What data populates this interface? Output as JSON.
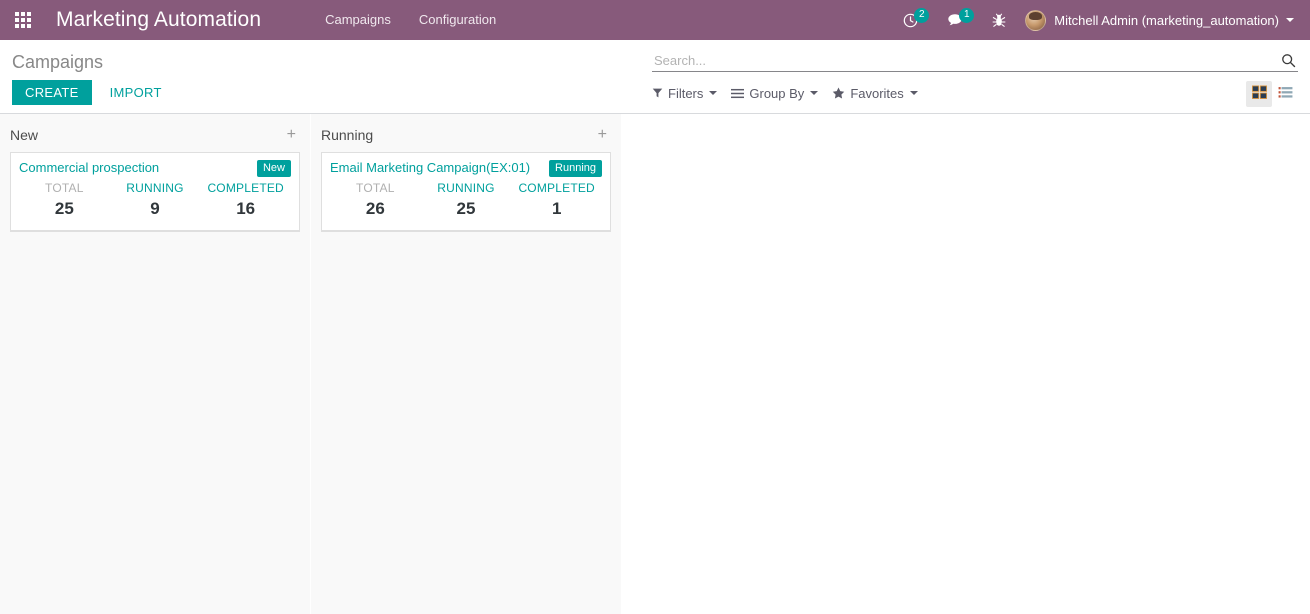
{
  "navbar": {
    "apps_icon": "apps-grid-icon",
    "brand": "Marketing Automation",
    "menu": [
      {
        "label": "Campaigns"
      },
      {
        "label": "Configuration"
      }
    ],
    "systray": {
      "activities_icon": "clock-icon",
      "activities_count": "2",
      "messages_icon": "chat-bubble-icon",
      "messages_count": "1",
      "debug_icon": "bug-icon"
    },
    "user": {
      "name": "Mitchell Admin (marketing_automation)",
      "avatar_icon": "avatar-icon",
      "caret_icon": "chevron-down-icon"
    }
  },
  "control_panel": {
    "breadcrumb": "Campaigns",
    "create_label": "CREATE",
    "import_label": "IMPORT",
    "search": {
      "placeholder": "Search...",
      "value": "",
      "icon": "search-icon"
    },
    "dropdowns": [
      {
        "label": "Filters",
        "icon": "filter-funnel-icon"
      },
      {
        "label": "Group By",
        "icon": "group-bars-icon"
      },
      {
        "label": "Favorites",
        "icon": "star-icon"
      }
    ],
    "views": [
      {
        "name": "kanban",
        "icon": "kanban-grid-icon",
        "active": true
      },
      {
        "name": "list",
        "icon": "list-view-icon",
        "active": false
      }
    ]
  },
  "kanban": {
    "add_icon": "plus-icon",
    "columns": [
      {
        "title": "New",
        "cards": [
          {
            "title": "Commercial prospection",
            "state": "New",
            "stats": [
              {
                "label": "TOTAL",
                "value": "25",
                "style": "muted"
              },
              {
                "label": "RUNNING",
                "value": "9",
                "style": "link"
              },
              {
                "label": "COMPLETED",
                "value": "16",
                "style": "link"
              }
            ]
          }
        ]
      },
      {
        "title": "Running",
        "cards": [
          {
            "title": "Email Marketing Campaign(EX:01)",
            "state": "Running",
            "stats": [
              {
                "label": "TOTAL",
                "value": "26",
                "style": "muted"
              },
              {
                "label": "RUNNING",
                "value": "25",
                "style": "link"
              },
              {
                "label": "COMPLETED",
                "value": "1",
                "style": "link"
              }
            ]
          }
        ]
      }
    ]
  },
  "colors": {
    "brand_purple": "#875A7B",
    "accent_teal": "#00A09D",
    "column_bg": "#f9f9f9",
    "text": "#4c4c4c"
  }
}
